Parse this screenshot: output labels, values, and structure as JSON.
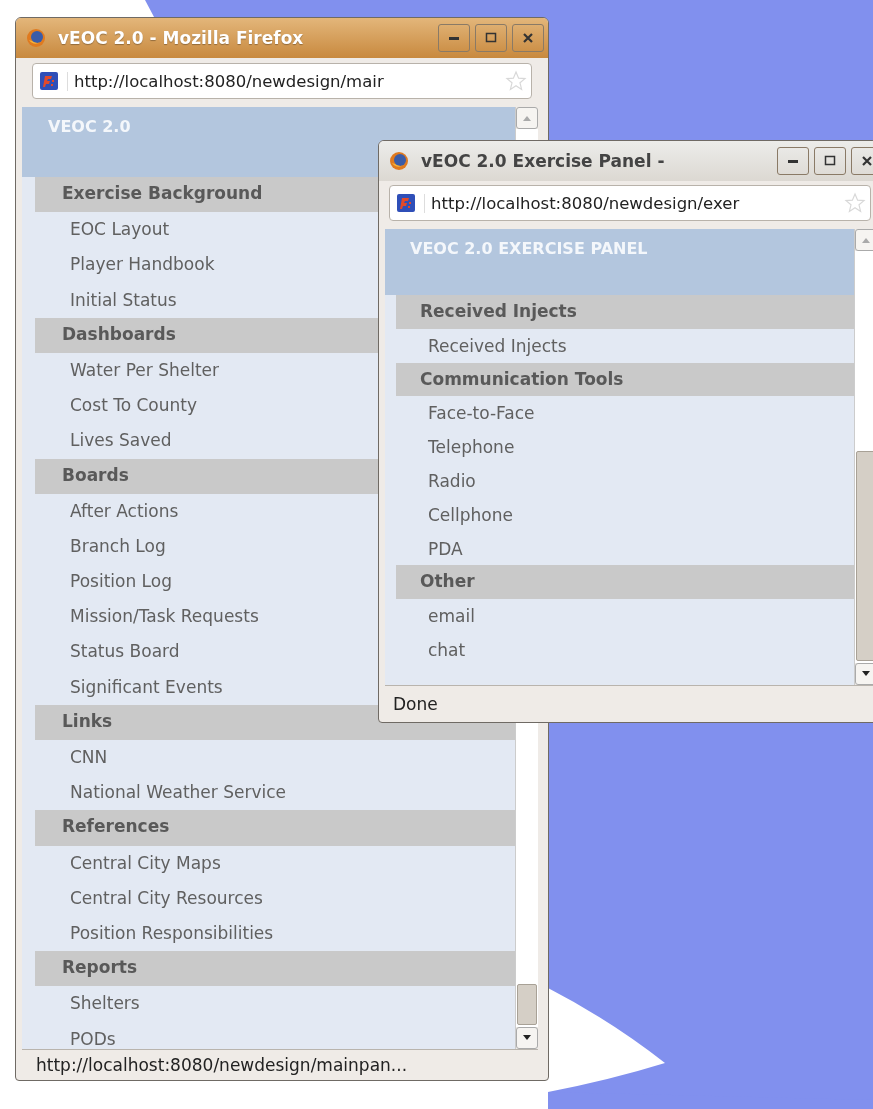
{
  "windows": [
    {
      "title": "vEOC 2.0 - Mozilla Firefox",
      "focused": true,
      "url": "http://localhost:8080/newdesign/mair",
      "page_title": "VEOC 2.0",
      "sections": [
        {
          "heading": "Exercise Background",
          "items": [
            "EOC Layout",
            "Player Handbook",
            "Initial Status"
          ]
        },
        {
          "heading": "Dashboards",
          "items": [
            "Water Per Shelter",
            "Cost To County",
            "Lives Saved"
          ]
        },
        {
          "heading": "Boards",
          "items": [
            "After Actions",
            "Branch Log",
            "Position Log",
            "Mission/Task Requests",
            "Status Board",
            "Significant Events"
          ]
        },
        {
          "heading": "Links",
          "items": [
            "CNN",
            "National Weather Service"
          ]
        },
        {
          "heading": "References",
          "items": [
            "Central City Maps",
            "Central City Resources",
            "Position Responsibilities"
          ]
        },
        {
          "heading": "Reports",
          "items": [
            "Shelters",
            "PODs"
          ]
        }
      ],
      "status": "http://localhost:8080/newdesign/mainpan..."
    },
    {
      "title": "vEOC 2.0 Exercise Panel -",
      "focused": false,
      "url": "http://localhost:8080/newdesign/exer",
      "page_title": "VEOC 2.0 EXERCISE PANEL",
      "sections": [
        {
          "heading": "Received Injects",
          "items": [
            "Received Injects"
          ]
        },
        {
          "heading": "Communication Tools",
          "items": [
            "Face-to-Face",
            "Telephone",
            "Radio",
            "Cellphone",
            "PDA"
          ]
        },
        {
          "heading": "Other",
          "items": [
            "email",
            "chat"
          ]
        }
      ],
      "status": "Done"
    }
  ]
}
